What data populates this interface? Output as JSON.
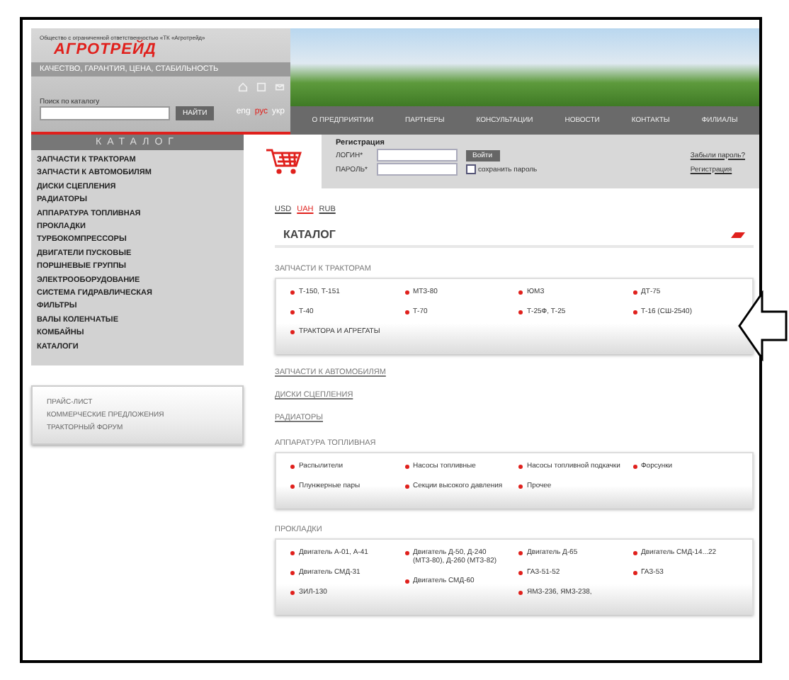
{
  "header": {
    "org_line": "Общество с ограниченной ответственностью «ТК «Агротрейд»",
    "logo": "АГРОТРЕЙД",
    "tagline": "КАЧЕСТВО, ГАРАНТИЯ, ЦЕНА, СТАБИЛЬНОСТЬ",
    "search": {
      "label": "Поиск по каталогу",
      "button": "НАЙТИ"
    },
    "languages": [
      {
        "label": "eng",
        "selected": false
      },
      {
        "label": "рус",
        "selected": true
      },
      {
        "label": "укр",
        "selected": false
      }
    ]
  },
  "nav": [
    "О ПРЕДПРИЯТИИ",
    "ПАРТНЕРЫ",
    "КОНСУЛЬТАЦИИ",
    "НОВОСТИ",
    "КОНТАКТЫ",
    "ФИЛИАЛЫ"
  ],
  "login": {
    "title": "Регистрация",
    "login_label": "ЛОГИН*",
    "password_label": "ПАРОЛЬ*",
    "button": "Войти",
    "remember": {
      "label": "сохранить пароль",
      "checked": false
    },
    "links": [
      "Забыли пароль?",
      "Регистрация"
    ]
  },
  "sidebar": {
    "title": "КАТАЛОГ",
    "items": [
      "ЗАПЧАСТИ К ТРАКТОРАМ",
      "ЗАПЧАСТИ К АВТОМОБИЛЯМ",
      "ДИСКИ СЦЕПЛЕНИЯ",
      "РАДИАТОРЫ",
      "АППАРАТУРА ТОПЛИВНАЯ",
      "ПРОКЛАДКИ",
      "ТУРБОКОМПРЕССОРЫ",
      "ДВИГАТЕЛИ ПУСКОВЫЕ",
      "ПОРШНЕВЫЕ ГРУППЫ",
      "ЭЛЕКТРООБОРУДОВАНИЕ",
      "СИСТЕМА ГИДРАВЛИЧЕСКАЯ",
      "ФИЛЬТРЫ",
      "ВАЛЫ КОЛЕНЧАТЫЕ",
      "КОМБАЙНЫ",
      "КАТАЛОГИ"
    ],
    "links": [
      "ПРАЙС-ЛИСТ",
      "КОММЕРЧЕСКИЕ ПРЕДЛОЖЕНИЯ",
      "ТРАКТОРНЫЙ ФОРУМ"
    ]
  },
  "currencies": [
    {
      "label": "USD",
      "selected": false
    },
    {
      "label": "UAH",
      "selected": true
    },
    {
      "label": "RUB",
      "selected": false
    }
  ],
  "catalog_title": "КАТАЛОГ",
  "sections": [
    {
      "kind": "grid",
      "title": "ЗАПЧАСТИ К ТРАКТОРАМ",
      "columns": [
        [
          "Т-150, Т-151",
          "Т-40",
          "ТРАКТОРА И АГРЕГАТЫ"
        ],
        [
          "МТЗ-80",
          "Т-70"
        ],
        [
          "ЮМЗ",
          "Т-25Ф, Т-25"
        ],
        [
          "ДТ-75",
          "Т-16 (СШ-2540)"
        ]
      ]
    },
    {
      "kind": "link",
      "title": "ЗАПЧАСТИ К АВТОМОБИЛЯМ"
    },
    {
      "kind": "link",
      "title": "ДИСКИ СЦЕПЛЕНИЯ"
    },
    {
      "kind": "link",
      "title": "РАДИАТОРЫ"
    },
    {
      "kind": "grid",
      "title": "АППАРАТУРА ТОПЛИВНАЯ",
      "columns": [
        [
          "Распылители",
          "Плунжерные пары"
        ],
        [
          "Насосы топливные",
          "Секции высокого давления"
        ],
        [
          "Насосы топливной подкачки",
          "Прочее"
        ],
        [
          "Форсунки"
        ]
      ]
    },
    {
      "kind": "grid",
      "title": "ПРОКЛАДКИ",
      "columns": [
        [
          "Двигатель А-01, А-41",
          "Двигатель СМД-31",
          "ЗИЛ-130"
        ],
        [
          "Двигатель Д-50, Д-240 (МТЗ-80), Д-260 (МТЗ-82)",
          "Двигатель СМД-60"
        ],
        [
          "Двигатель Д-65",
          "ГАЗ-51-52",
          "ЯМЗ-236, ЯМЗ-238,"
        ],
        [
          "Двигатель СМД-14...22",
          "ГАЗ-53"
        ]
      ]
    }
  ]
}
